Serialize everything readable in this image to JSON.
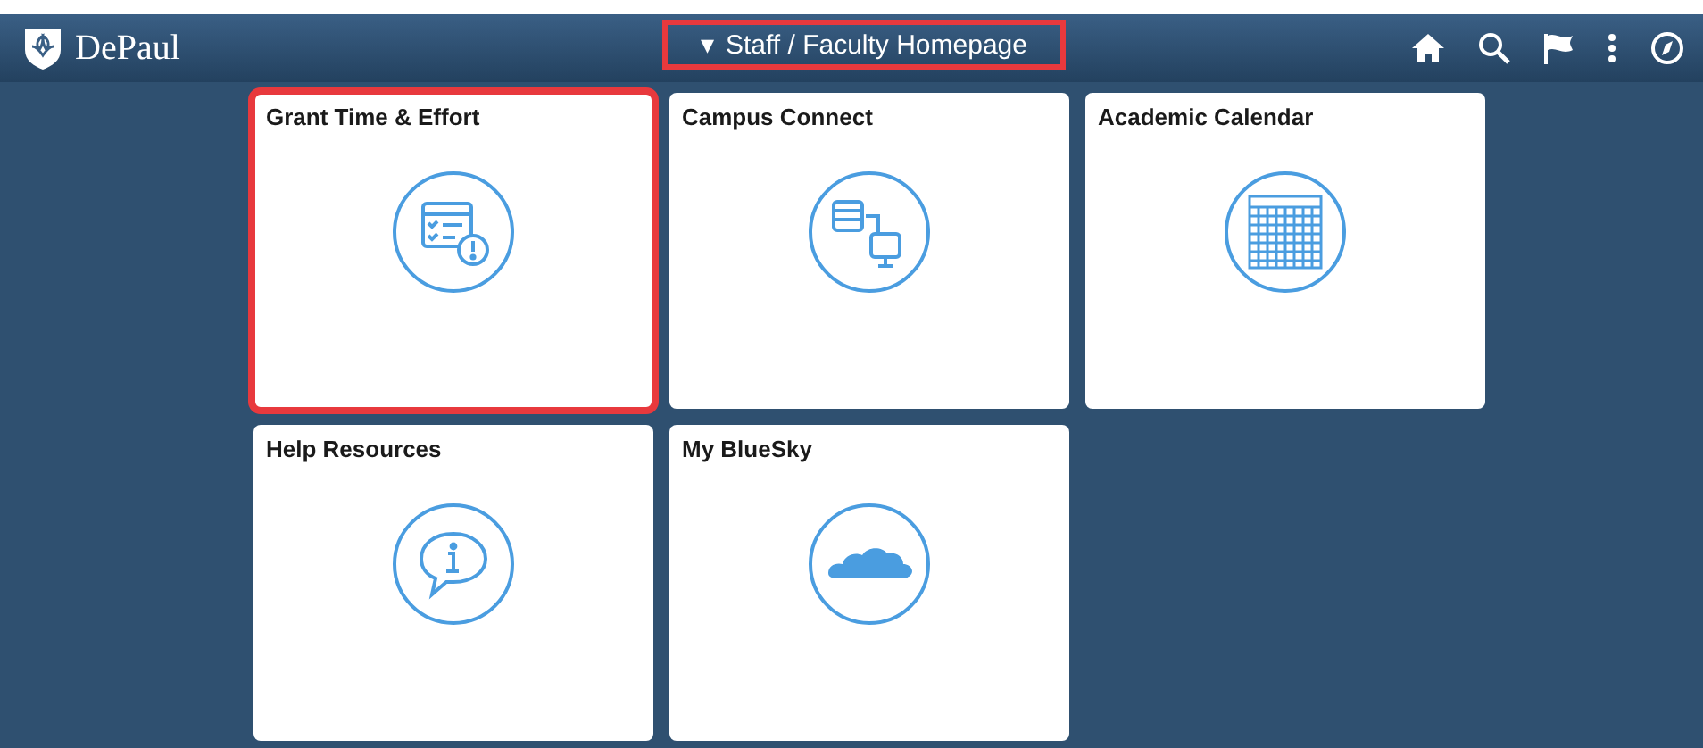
{
  "header": {
    "logo": "DePaul",
    "title": {
      "label": "Staff / Faculty Homepage",
      "arrow": "▾",
      "highlighted": true
    }
  },
  "tiles": [
    {
      "title": "Grant Time & Effort",
      "kind": "timesheet",
      "highlighted": true
    },
    {
      "title": "Campus Connect",
      "kind": "connect",
      "highlighted": false
    },
    {
      "title": "Academic Calendar",
      "kind": "calendar",
      "highlighted": false
    },
    {
      "title": "Help Resources",
      "kind": "help",
      "highlighted": false
    },
    {
      "title": "My BlueSky",
      "kind": "cloud",
      "highlighted": false
    }
  ]
}
